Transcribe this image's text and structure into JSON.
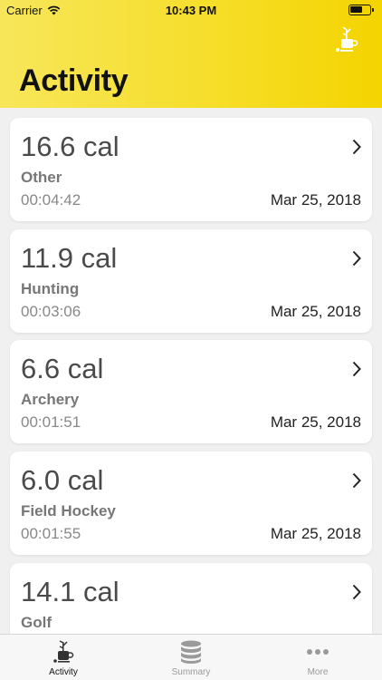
{
  "status_bar": {
    "carrier": "Carrier",
    "time": "10:43 PM"
  },
  "header": {
    "title": "Activity",
    "icon": "golf-bag-cup-icon"
  },
  "activities": [
    {
      "calories": "16.6 cal",
      "type": "Other",
      "duration": "00:04:42",
      "date": "Mar 25, 2018"
    },
    {
      "calories": "11.9 cal",
      "type": "Hunting",
      "duration": "00:03:06",
      "date": "Mar 25, 2018"
    },
    {
      "calories": "6.6 cal",
      "type": "Archery",
      "duration": "00:01:51",
      "date": "Mar 25, 2018"
    },
    {
      "calories": "6.0 cal",
      "type": "Field Hockey",
      "duration": "00:01:55",
      "date": "Mar 25, 2018"
    },
    {
      "calories": "14.1 cal",
      "type": "Golf",
      "duration": "",
      "date": ""
    }
  ],
  "tabs": [
    {
      "label": "Activity",
      "icon": "golf-bag-icon",
      "active": true
    },
    {
      "label": "Summary",
      "icon": "database-icon",
      "active": false
    },
    {
      "label": "More",
      "icon": "more-dots-icon",
      "active": false
    }
  ],
  "colors": {
    "header_start": "#f7e65a",
    "header_end": "#f4d400",
    "background": "#f0f0f0",
    "card": "#ffffff"
  }
}
